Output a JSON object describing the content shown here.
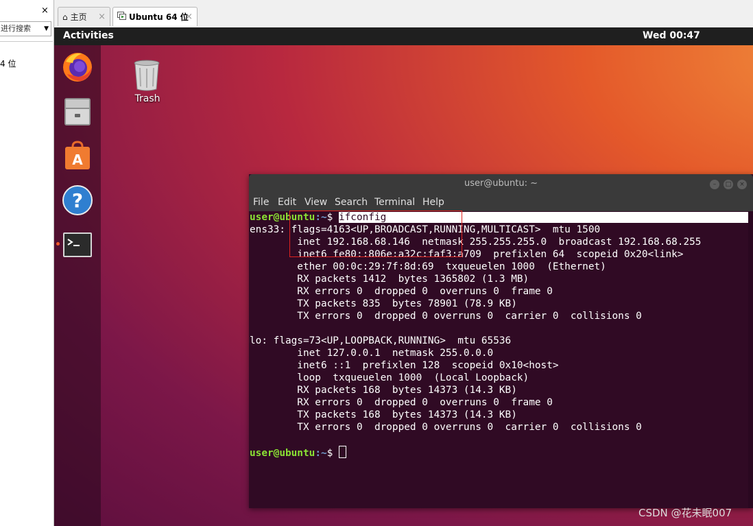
{
  "library": {
    "close_glyph": "×",
    "search_placeholder": "进行搜索",
    "item_label": "4 位"
  },
  "tabs": [
    {
      "label": "主页",
      "icon": "home-icon"
    },
    {
      "label": "Ubuntu 64 位",
      "icon": "vm-icon"
    }
  ],
  "tab_close_glyph": "×",
  "topbar": {
    "activities": "Activities",
    "clock": "Wed 00:47"
  },
  "dock": [
    "firefox-icon",
    "files-icon",
    "software-icon",
    "help-icon",
    "terminal-icon"
  ],
  "desktop": {
    "trash_label": "Trash"
  },
  "terminal": {
    "title": "user@ubuntu: ~",
    "menu": [
      "File",
      "Edit",
      "View",
      "Search",
      "Terminal",
      "Help"
    ],
    "prompt_user": "user@ubuntu",
    "prompt_path": ":~",
    "prompt_symbol": "$ ",
    "command": "ifconfig",
    "output": [
      "ens33: flags=4163<UP,BROADCAST,RUNNING,MULTICAST>  mtu 1500",
      "        inet 192.168.68.146  netmask 255.255.255.0  broadcast 192.168.68.255",
      "        inet6 fe80::806e:a32c:faf3:a709  prefixlen 64  scopeid 0x20<link>",
      "        ether 00:0c:29:7f:8d:69  txqueuelen 1000  (Ethernet)",
      "        RX packets 1412  bytes 1365802 (1.3 MB)",
      "        RX errors 0  dropped 0  overruns 0  frame 0",
      "        TX packets 835  bytes 78901 (78.9 KB)",
      "        TX errors 0  dropped 0 overruns 0  carrier 0  collisions 0",
      "",
      "lo: flags=73<UP,LOOPBACK,RUNNING>  mtu 65536",
      "        inet 127.0.0.1  netmask 255.0.0.0",
      "        inet6 ::1  prefixlen 128  scopeid 0x10<host>",
      "        loop  txqueuelen 1000  (Local Loopback)",
      "        RX packets 168  bytes 14373 (14.3 KB)",
      "        RX errors 0  dropped 0  overruns 0  frame 0",
      "        TX packets 168  bytes 14373 (14.3 KB)",
      "        TX errors 0  dropped 0 overruns 0  carrier 0  collisions 0",
      ""
    ]
  },
  "watermark": "CSDN @花未眠007",
  "colors": {
    "accent": "#e95420",
    "terminal_bg": "#300a24",
    "prompt_user": "#8ae234",
    "prompt_path": "#729fcf",
    "highlight_box": "#e0231f"
  }
}
